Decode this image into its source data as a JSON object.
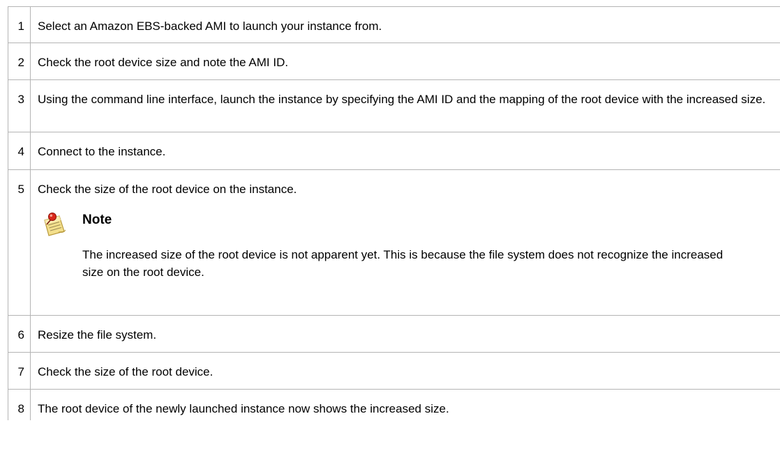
{
  "steps": [
    {
      "number": "1",
      "text": "Select an Amazon EBS-backed AMI to launch your instance from."
    },
    {
      "number": "2",
      "text": "Check the root device size and note the AMI ID."
    },
    {
      "number": "3",
      "text": "Using the command line interface, launch the instance by specifying the AMI ID and the mapping of the root device with the increased size."
    },
    {
      "number": "4",
      "text": "Connect to the instance."
    },
    {
      "number": "5",
      "text": "Check the size of the root device on the instance."
    },
    {
      "number": "6",
      "text": "Resize the file system."
    },
    {
      "number": "7",
      "text": "Check the size of the root device."
    },
    {
      "number": "8",
      "text": "The root device of the newly launched instance now shows the increased size."
    }
  ],
  "note": {
    "icon": "note-icon",
    "title": "Note",
    "body": "The increased size of the root device is not apparent yet. This is because the file system does not recognize the increased size on the root device."
  }
}
